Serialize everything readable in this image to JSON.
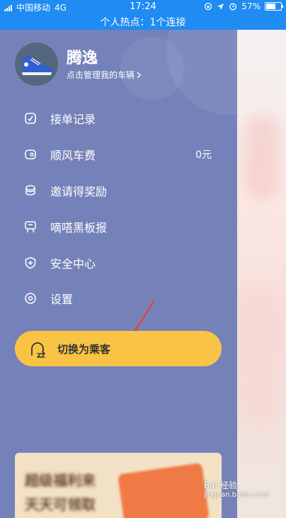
{
  "status_bar": {
    "carrier": "中国移动",
    "network": "4G",
    "time": "17:24",
    "battery": "57%",
    "hotspot_text": "个人热点：1个连接",
    "battery_level": 0.57
  },
  "profile": {
    "name": "腾逸",
    "manage_text": "点击管理我的车辆"
  },
  "menu": [
    {
      "label": "接单记录",
      "icon": "order-record-icon"
    },
    {
      "label": "顺风车费",
      "icon": "wallet-icon",
      "value": "0元"
    },
    {
      "label": "邀请得奖励",
      "icon": "gift-icon"
    },
    {
      "label": "嘀嗒黑板报",
      "icon": "blackboard-icon"
    },
    {
      "label": "安全中心",
      "icon": "shield-icon"
    },
    {
      "label": "设置",
      "icon": "settings-icon"
    }
  ],
  "switch_button": {
    "label": "切换为乘客"
  },
  "banner": {
    "line1": "超级福利来",
    "line2": "天天可领取"
  },
  "watermark": {
    "text": "Bai 经验",
    "url": "jingyan.baidu.com"
  },
  "colors": {
    "status_bar": "#1f8bf3",
    "drawer": "#7582b9",
    "switch_button": "#f9c445",
    "annotation_arrow": "#e8413b"
  }
}
